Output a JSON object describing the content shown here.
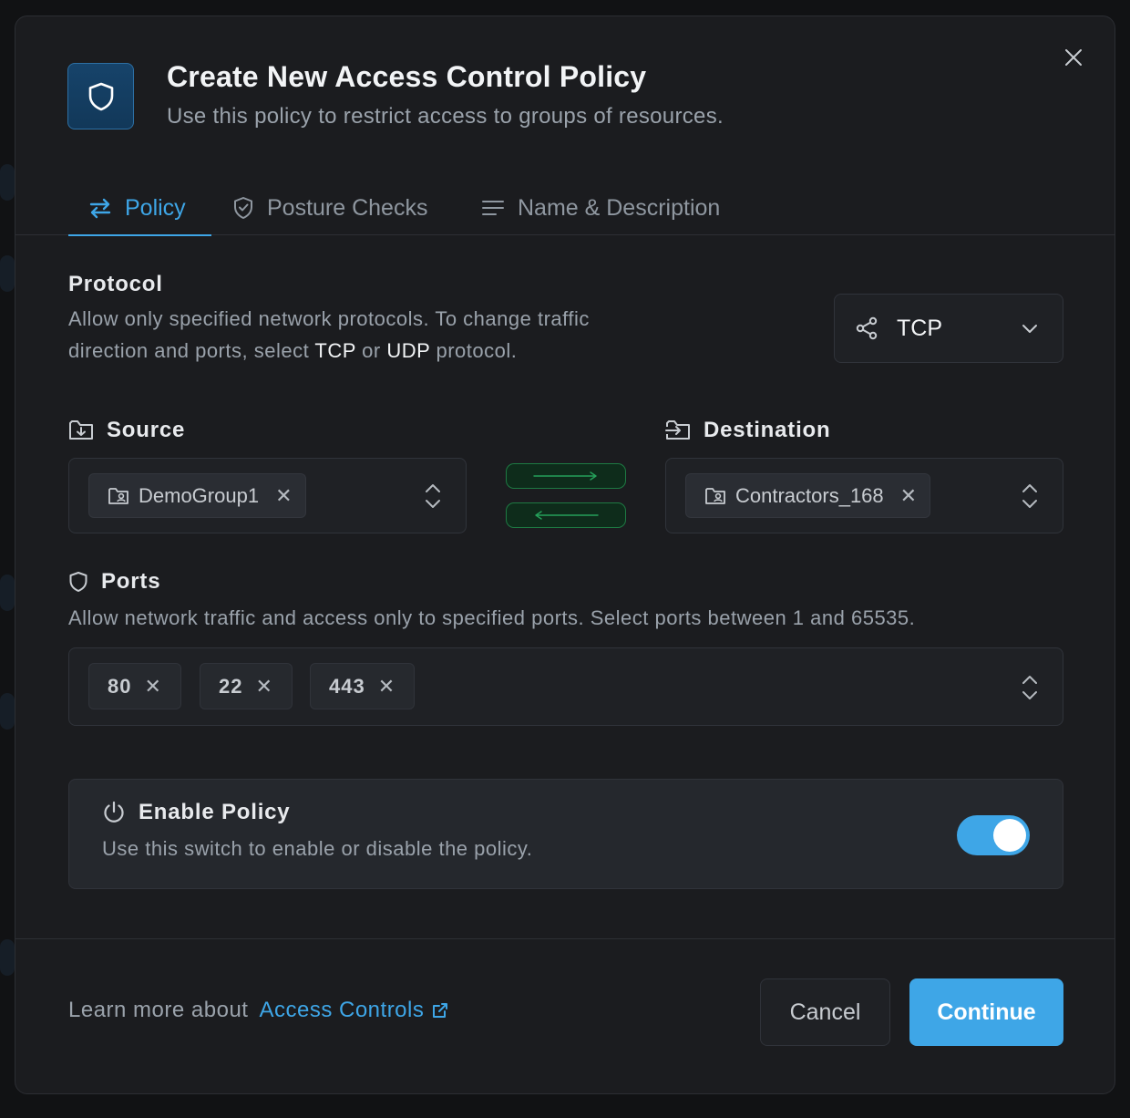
{
  "dialog": {
    "title": "Create New Access Control Policy",
    "subtitle": "Use this policy to restrict access to groups of resources."
  },
  "tabs": [
    {
      "label": "Policy",
      "icon": "arrows-exchange-icon",
      "active": true
    },
    {
      "label": "Posture Checks",
      "icon": "shield-check-icon",
      "active": false
    },
    {
      "label": "Name & Description",
      "icon": "text-lines-icon",
      "active": false
    }
  ],
  "protocol": {
    "label": "Protocol",
    "desc_part1": "Allow only specified network protocols. To change traffic",
    "desc_part2": "direction and ports, select ",
    "tcp": "TCP",
    "or": " or ",
    "udp": "UDP",
    "desc_end": " protocol.",
    "selected": "TCP"
  },
  "source": {
    "label": "Source",
    "groups": [
      "DemoGroup1"
    ]
  },
  "destination": {
    "label": "Destination",
    "groups": [
      "Contractors_168"
    ]
  },
  "ports": {
    "label": "Ports",
    "description": "Allow network traffic and access only to specified ports. Select ports between 1 and 65535.",
    "values": [
      "80",
      "22",
      "443"
    ]
  },
  "enable": {
    "label": "Enable Policy",
    "description": "Use this switch to enable or disable the policy.",
    "enabled": true
  },
  "footer": {
    "learn_prefix": "Learn more about",
    "learn_link": "Access Controls",
    "cancel": "Cancel",
    "continue": "Continue"
  },
  "colors": {
    "accent": "#3ea6e7",
    "direction_green": "#1e7a43",
    "background": "#1b1c1f"
  }
}
